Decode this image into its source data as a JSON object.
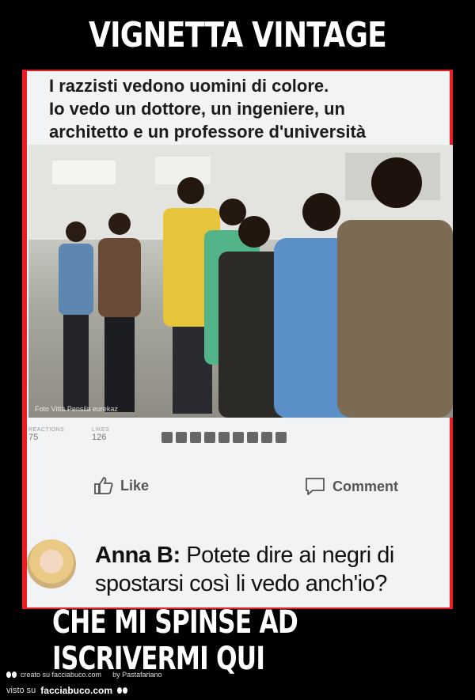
{
  "meme": {
    "top_caption": "VIGNETTA VINTAGE",
    "bottom_caption": "CHE MI SPINSE AD ISCRIVERMI QUI"
  },
  "post": {
    "text_line1": "I razzisti vedono uomini di colore.",
    "text_line2": "Io vedo un dottore, un ingeniere, un",
    "text_line3": "architetto e un professore d'università",
    "photo_credit": "Foto Vittà Pensila eurekaz",
    "stats": {
      "reactions_label": "REACTIONS",
      "reactions_value": "75",
      "likes_label": "LIKES",
      "likes_value": "126"
    },
    "actions": {
      "like_label": "Like",
      "comment_label": "Comment"
    }
  },
  "comment": {
    "author": "Anna B:",
    "text": "Potete dire ai negri di spostarsi così li vedo anch'io?"
  },
  "footer": {
    "created_on": "creato su facciabuco.com",
    "by": "by Pastafariano",
    "seen_on": "visto su",
    "site": "facciabuco.com"
  },
  "colors": {
    "frame": "#ed1c24",
    "background": "#000000",
    "post_bg": "#f2f3f5"
  }
}
